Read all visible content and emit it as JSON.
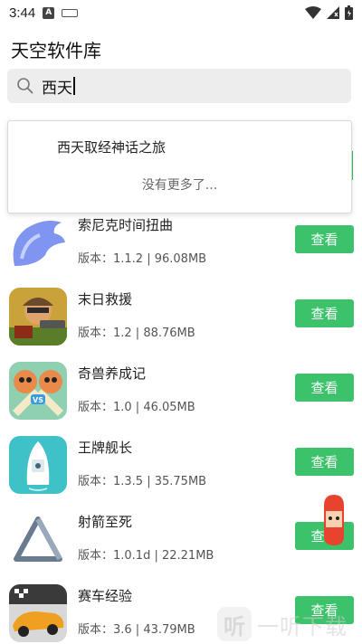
{
  "status_bar": {
    "time": "3:44",
    "notif_letter": "A"
  },
  "app": {
    "title": "天空软件库"
  },
  "search": {
    "query": "西天"
  },
  "suggestions": {
    "item": "西天取经神话之旅",
    "more": "没有更多了..."
  },
  "accent": "#3cc26a",
  "apps": [
    {
      "name": "索尼克时间扭曲",
      "version_label": "版本：1.1.2 | 96.08MB",
      "button": "查看",
      "icon": "sonic-ring-icon"
    },
    {
      "name": "末日救援",
      "version_label": "版本：1.2 | 88.76MB",
      "button": "查看",
      "icon": "soldier-icon"
    },
    {
      "name": "奇兽养成记",
      "version_label": "版本：1.0 | 46.05MB",
      "button": "查看",
      "icon": "cats-vs-icon"
    },
    {
      "name": "王牌舰长",
      "version_label": "版本：1.3.5 | 35.75MB",
      "button": "查看",
      "icon": "boat-icon"
    },
    {
      "name": "射箭至死",
      "version_label": "版本：1.0.1d | 22.21MB",
      "button": "查看",
      "icon": "triangle-icon"
    },
    {
      "name": "赛车经验",
      "version_label": "版本：3.6 | 43.79MB",
      "button": "查看",
      "icon": "race-car-icon"
    }
  ],
  "watermark": {
    "logo": "听",
    "text": "一听下载"
  }
}
